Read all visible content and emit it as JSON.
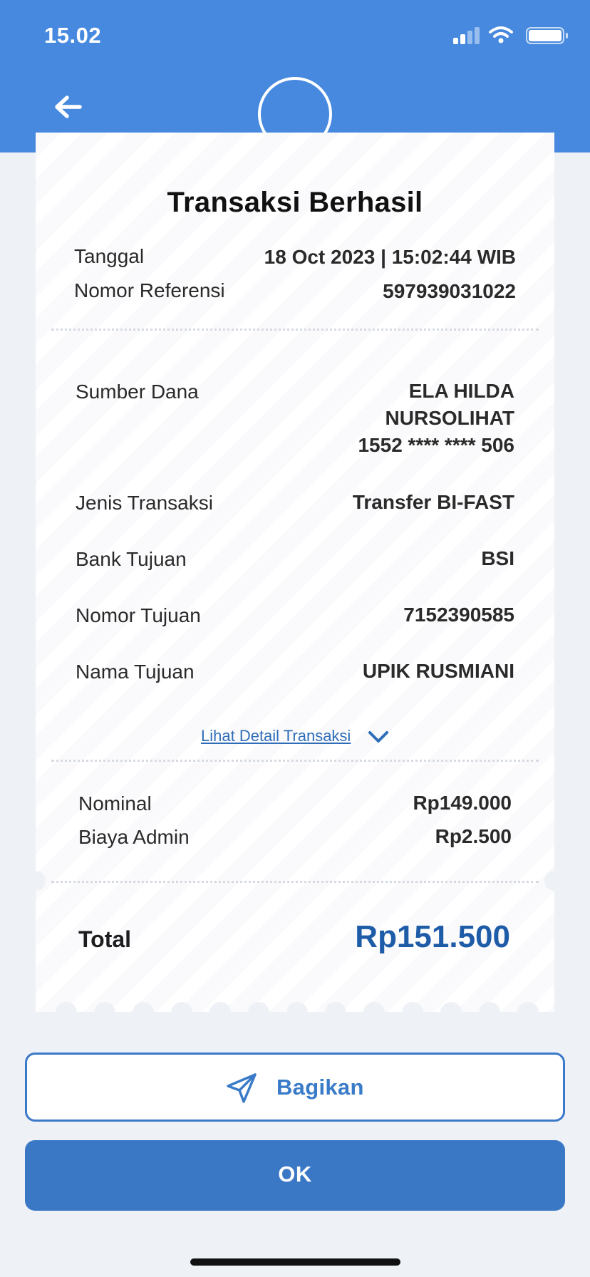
{
  "status_bar": {
    "time": "15.02",
    "icons": [
      "cellular-signal-icon",
      "wifi-icon",
      "battery-icon"
    ]
  },
  "header": {
    "back_icon": "arrow-left-icon"
  },
  "receipt": {
    "title": "Transaksi Berhasil",
    "meta": [
      {
        "label": "Tanggal",
        "value": "18 Oct 2023 | 15:02:44 WIB"
      },
      {
        "label": "Nomor Referensi",
        "value": "597939031022"
      }
    ],
    "details": {
      "source_label": "Sumber Dana",
      "source_name_line1": "ELA HILDA",
      "source_name_line2": "NURSOLIHAT",
      "source_account": "1552 **** **** 506",
      "type_label": "Jenis Transaksi",
      "type_value": "Transfer BI-FAST",
      "bank_label": "Bank Tujuan",
      "bank_value": "BSI",
      "dest_number_label": "Nomor Tujuan",
      "dest_number_value": "7152390585",
      "dest_name_label": "Nama Tujuan",
      "dest_name_value": "UPIK RUSMIANI"
    },
    "detail_link": "Lihat Detail Transaksi",
    "amounts": [
      {
        "label": "Nominal",
        "value": "Rp149.000"
      },
      {
        "label": "Biaya Admin",
        "value": "Rp2.500"
      }
    ],
    "total_label": "Total",
    "total_value": "Rp151.500"
  },
  "actions": {
    "share_label": "Bagikan",
    "ok_label": "OK"
  },
  "colors": {
    "brand_blue": "#4689df",
    "button_blue": "#3a78c6",
    "total_blue": "#1f5ca8",
    "background": "#eef1f6"
  }
}
